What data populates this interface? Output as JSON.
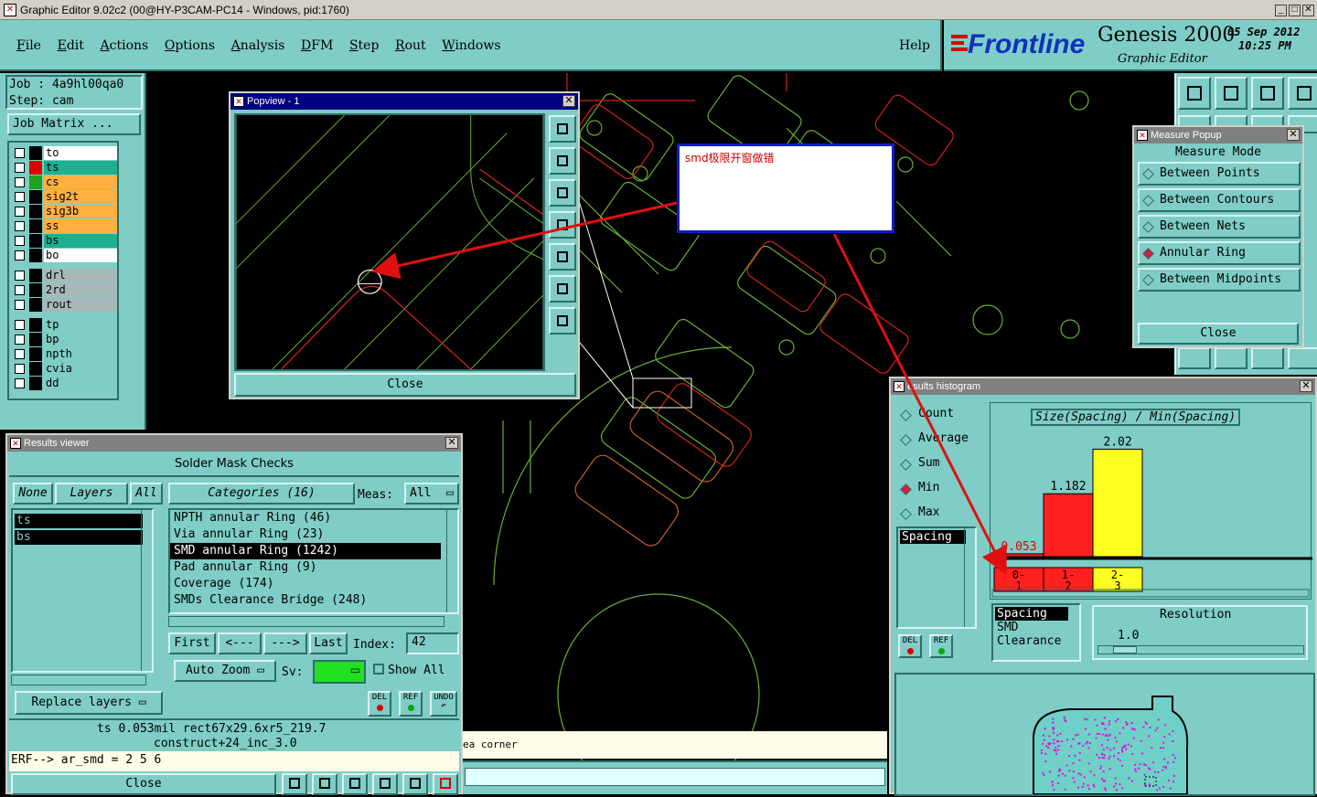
{
  "window_title": "Graphic Editor 9.02c2 (00@HY-P3CAM-PC14 - Windows, pid:1760)",
  "menu": [
    "File",
    "Edit",
    "Actions",
    "Options",
    "Analysis",
    "DFM",
    "Step",
    "Rout",
    "Windows"
  ],
  "help": "Help",
  "brand": {
    "logo": "Frontline",
    "product": "Genesis 2000",
    "subtitle": "Graphic Editor",
    "date": "05 Sep 2012",
    "time": "10:25 PM"
  },
  "job": {
    "job_label": "Job : 4a9hl00qa0",
    "step_label": "Step: cam",
    "matrix_button": "Job Matrix ..."
  },
  "layers": [
    {
      "name": "to",
      "color": "#ffffff"
    },
    {
      "name": "ts",
      "color": "#1faf90"
    },
    {
      "name": "cs",
      "color": "#ffb040"
    },
    {
      "name": "sig2t",
      "color": "#ffb040"
    },
    {
      "name": "sig3b",
      "color": "#ffb040"
    },
    {
      "name": "ss",
      "color": "#ffb040"
    },
    {
      "name": "bs",
      "color": "#1faf90"
    },
    {
      "name": "bo",
      "color": "#ffffff"
    }
  ],
  "layers2": [
    "drl",
    "2rd",
    "rout"
  ],
  "layers3": [
    "tp",
    "bp",
    "npth",
    "cvia",
    "dd"
  ],
  "popview": {
    "title": "Popview - 1",
    "close": "Close"
  },
  "annotation": "smd极限开窗做错",
  "measure": {
    "title": "Measure Popup",
    "header": "Measure Mode",
    "options": [
      "Between Points",
      "Between Contours",
      "Between Nets",
      "Annular Ring",
      "Between Midpoints"
    ],
    "selected": "Annular Ring",
    "close": "Close"
  },
  "results": {
    "title": "Results viewer",
    "header": "Solder Mask Checks",
    "none": "None",
    "layers": "Layers",
    "all": "All",
    "categories_btn": "Categories (16)",
    "meas_label": "Meas:",
    "meas_value": "All",
    "layer_list": [
      "ts",
      "bs"
    ],
    "categories": [
      "NPTH annular Ring (46)",
      "Via annular Ring (23)",
      "SMD annular Ring (1242)",
      "Pad annular Ring (9)",
      "Coverage (174)",
      "SMDs Clearance Bridge (248)"
    ],
    "selected_category": "SMD annular Ring (1242)",
    "first": "First",
    "prev": "<---",
    "next": "--->",
    "last": "Last",
    "index_label": "Index:",
    "index_value": "42",
    "auto_zoom": "Auto Zoom",
    "sv_label": "Sv:",
    "show_all": "Show All",
    "replace_layers": "Replace layers",
    "del": "DEL",
    "ref": "REF",
    "undo": "UNDO",
    "info_line1": "ts 0.053mil  rect67x29.6xr5_219.7",
    "info_line2": "construct+24_inc_3.0",
    "erf_line": "ERF--> ar_smd = 2 5 6",
    "close": "Close"
  },
  "status_text": "ea corner",
  "histogram": {
    "title": "esults histogram",
    "modes": [
      "Count",
      "Average",
      "Sum",
      "Min",
      "Max"
    ],
    "selected_mode": "Min",
    "chart_title": "Size(Spacing) / Min(Spacing)",
    "list_top": [
      "Spacing"
    ],
    "list_bottom": [
      "Spacing",
      "SMD",
      "Clearance"
    ],
    "resolution_label": "Resolution",
    "resolution_value": "1.0",
    "del": "DEL",
    "ref": "REF"
  },
  "chart_data": {
    "type": "bar",
    "title": "Size(Spacing) / Min(Spacing)",
    "categories": [
      "0-1",
      "1-2",
      "2-3"
    ],
    "values": [
      0.053,
      1.182,
      2.02
    ],
    "colors": [
      "#ff2020",
      "#ff2020",
      "#ffff20"
    ],
    "ylim": [
      0,
      2.2
    ]
  }
}
